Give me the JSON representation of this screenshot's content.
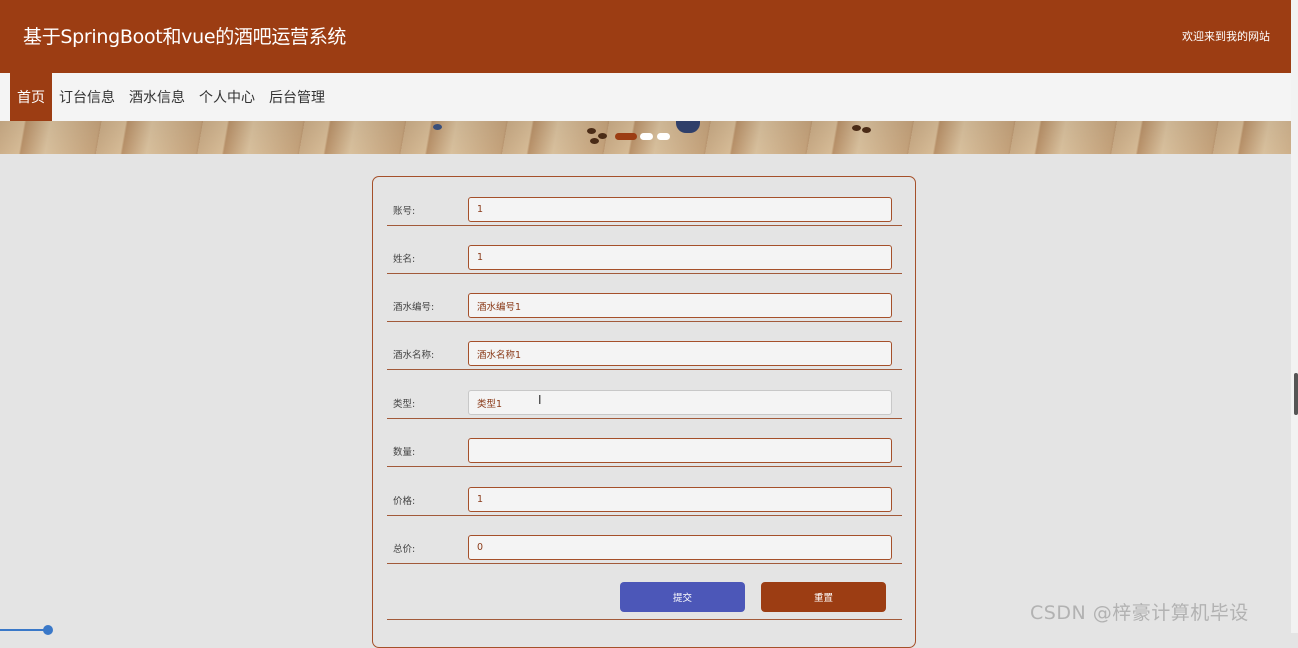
{
  "header": {
    "title": "基于SpringBoot和vue的酒吧运营系统",
    "welcome": "欢迎来到我的网站"
  },
  "nav": {
    "items": [
      {
        "label": "首页",
        "active": true
      },
      {
        "label": "订台信息",
        "active": false
      },
      {
        "label": "酒水信息",
        "active": false
      },
      {
        "label": "个人中心",
        "active": false
      },
      {
        "label": "后台管理",
        "active": false
      }
    ]
  },
  "form": {
    "fields": [
      {
        "label": "账号:",
        "value": "1"
      },
      {
        "label": "姓名:",
        "value": "1"
      },
      {
        "label": "酒水编号:",
        "value": "酒水编号1"
      },
      {
        "label": "酒水名称:",
        "value": "酒水名称1"
      },
      {
        "label": "类型:",
        "value": "类型1"
      },
      {
        "label": "数量:",
        "value": ""
      },
      {
        "label": "价格:",
        "value": "1"
      },
      {
        "label": "总价:",
        "value": "0"
      }
    ],
    "submit_label": "提交",
    "reset_label": "重置"
  },
  "watermark": "CSDN @梓豪计算机毕设",
  "colors": {
    "brand": "#9c3d13",
    "submit": "#4c57b8",
    "background": "#e4e4e4"
  }
}
